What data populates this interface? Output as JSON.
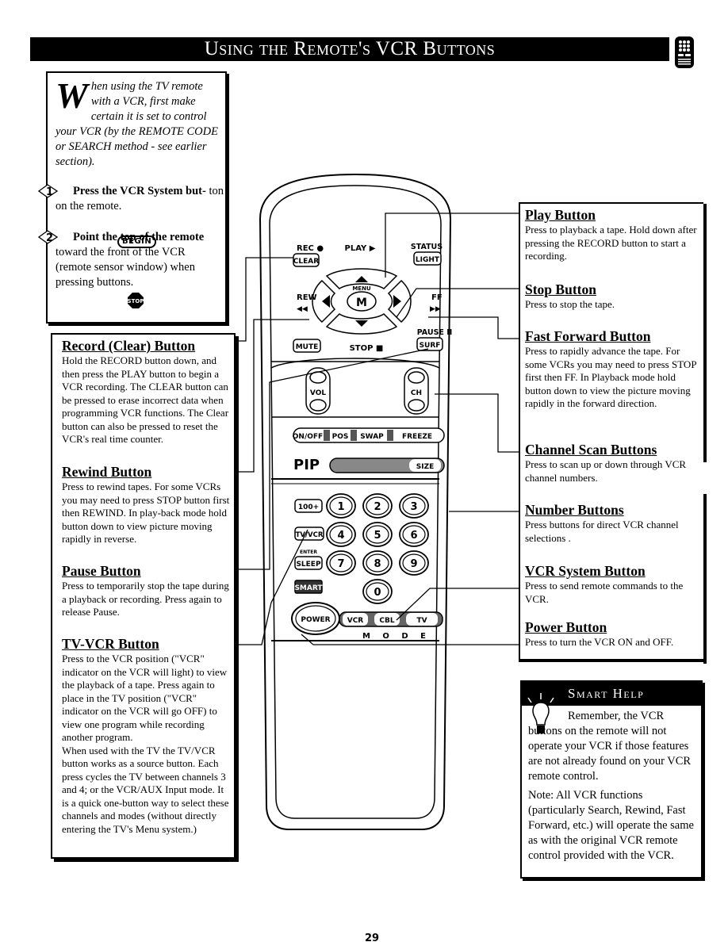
{
  "header": {
    "title": "Using the Remote's VCR Buttons",
    "icon": "remote-control-icon"
  },
  "intro": {
    "dropcap": "W",
    "text": "hen using the TV remote with a VCR, first make certain it is set to control your VCR (by the REMOTE CODE or SEARCH method - see earlier section).",
    "begin_label": "BEGIN",
    "steps": [
      {
        "number": "1",
        "bold": "Press the VCR System but-",
        "rest": "ton on the remote."
      },
      {
        "number": "2",
        "bold": "Point the top of the remote",
        "rest": "toward the front of the VCR (remote sensor window) when pressing buttons."
      }
    ],
    "stop_label": "STOP"
  },
  "left_descriptions": [
    {
      "title": "Record (Clear) Button",
      "body": "Hold the RECORD button down, and then press the PLAY button to begin a VCR recording. The CLEAR button can be pressed to erase incorrect data when programming VCR functions. The Clear button can also be pressed to reset the VCR's real time counter."
    },
    {
      "title": "Rewind Button",
      "body": "Press to rewind tapes. For some VCRs you may need to press STOP button first then REWIND. In play-back mode hold button down to view picture moving rapidly in reverse."
    },
    {
      "title": "Pause Button",
      "body": "Press to temporarily stop the tape during a playback or recording. Press again to release Pause."
    },
    {
      "title": "TV-VCR Button",
      "body": "Press to the VCR position (\"VCR\" indicator on the VCR will light) to view the playback of a tape. Press again to place in the TV position (\"VCR\" indicator on the VCR will go OFF) to view one program while recording another program.",
      "body2": "When used with the TV the TV/VCR button works as a source button. Each press cycles the TV between channels 3 and 4; or the VCR/AUX Input mode. It is a quick one-button way to select these channels and modes (without directly entering the TV's Menu system.)"
    }
  ],
  "right_descriptions": [
    {
      "title": "Play Button",
      "body": "Press to playback a tape. Hold down after pressing the RECORD button to start a recording."
    },
    {
      "title": "Stop Button",
      "body": "Press to stop the tape."
    },
    {
      "title": "Fast Forward Button",
      "body": "Press to rapidly advance the tape. For some VCRs you may need to press STOP first then FF. In Playback mode hold button down to view the picture moving rapidly in the forward direction."
    },
    {
      "title": "Channel Scan Buttons",
      "body": "Press to scan up or down through VCR channel numbers."
    },
    {
      "title": "Number Buttons",
      "body": "Press buttons for direct VCR channel selections ."
    },
    {
      "title": "VCR System Button",
      "body": "Press to send remote commands to the VCR."
    },
    {
      "title": "Power Button",
      "body": "Press to turn the VCR ON and OFF."
    }
  ],
  "smart_help": {
    "title": "Smart Help",
    "para1": "Remember, the VCR buttons on the remote will not operate your VCR if those features are not already found on your VCR remote control.",
    "para2": "Note: All VCR functions (particularly Search, Rewind, Fast Forward, etc.) will operate the same as with the original VCR remote control provided with the VCR."
  },
  "remote": {
    "rec": "REC ●",
    "clear": "CLEAR",
    "play": "PLAY ▶",
    "status": "STATUS",
    "light": "LIGHT",
    "menu": "MENU",
    "m": "M",
    "rew": "REW",
    "rew_sym": "◀◀",
    "ff": "FF",
    "ff_sym": "▶▶",
    "pause": "PAUSE II",
    "mute": "MUTE",
    "stop": "STOP ■",
    "surf": "SURF",
    "vol": "VOL",
    "ch": "CH",
    "pip_buttons": [
      "ON/OFF",
      "POS",
      "SWAP",
      "FREEZE"
    ],
    "pip_label": "PIP",
    "size": "SIZE",
    "hundred": "100+",
    "tvvcr": "TV/VCR",
    "enter": "ENTER",
    "sleep": "SLEEP",
    "smart": "SMART",
    "digits": [
      "1",
      "2",
      "3",
      "4",
      "5",
      "6",
      "7",
      "8",
      "9",
      "0"
    ],
    "power": "POWER",
    "modes": [
      "VCR",
      "CBL",
      "TV"
    ],
    "mode_label": "M O D E"
  },
  "page_number": "29"
}
